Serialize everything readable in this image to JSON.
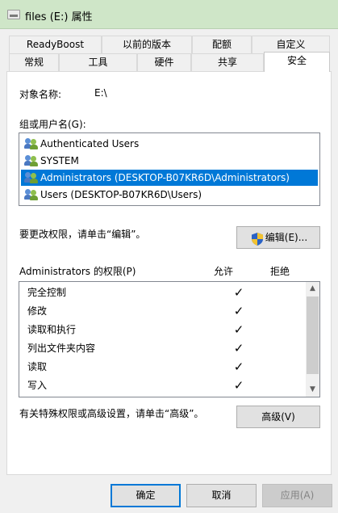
{
  "window": {
    "title": "files (E:) 属性"
  },
  "tabs_back": [
    "ReadyBoost",
    "以前的版本",
    "配额",
    "自定义"
  ],
  "tabs_front": [
    "常规",
    "工具",
    "硬件",
    "共享",
    "安全"
  ],
  "security": {
    "object_label": "对象名称:",
    "object_value": "E:\\",
    "group_label": "组或用户名(G):",
    "users": [
      "Authenticated Users",
      "SYSTEM",
      "Administrators (DESKTOP-B07KR6D\\Administrators)",
      "Users (DESKTOP-B07KR6D\\Users)"
    ],
    "edit_note": "要更改权限，请单击“编辑”。",
    "edit_button": "编辑(E)...",
    "permissions_label": "Administrators 的权限(P)",
    "allow_header": "允许",
    "deny_header": "拒绝",
    "permissions": [
      "完全控制",
      "修改",
      "读取和执行",
      "列出文件夹内容",
      "读取",
      "写入"
    ],
    "allowed_checks": [
      "✓",
      "✓",
      "✓",
      "✓",
      "✓",
      "✓"
    ],
    "advanced_note": "有关特殊权限或高级设置，请单击“高级”。",
    "advanced_button": "高级(V)"
  },
  "footer": {
    "ok": "确定",
    "cancel": "取消",
    "apply": "应用(A)"
  },
  "colors": {
    "selection": "#0078d7",
    "titlebar": "#cfe6c8",
    "default_border": "#0078d7"
  }
}
